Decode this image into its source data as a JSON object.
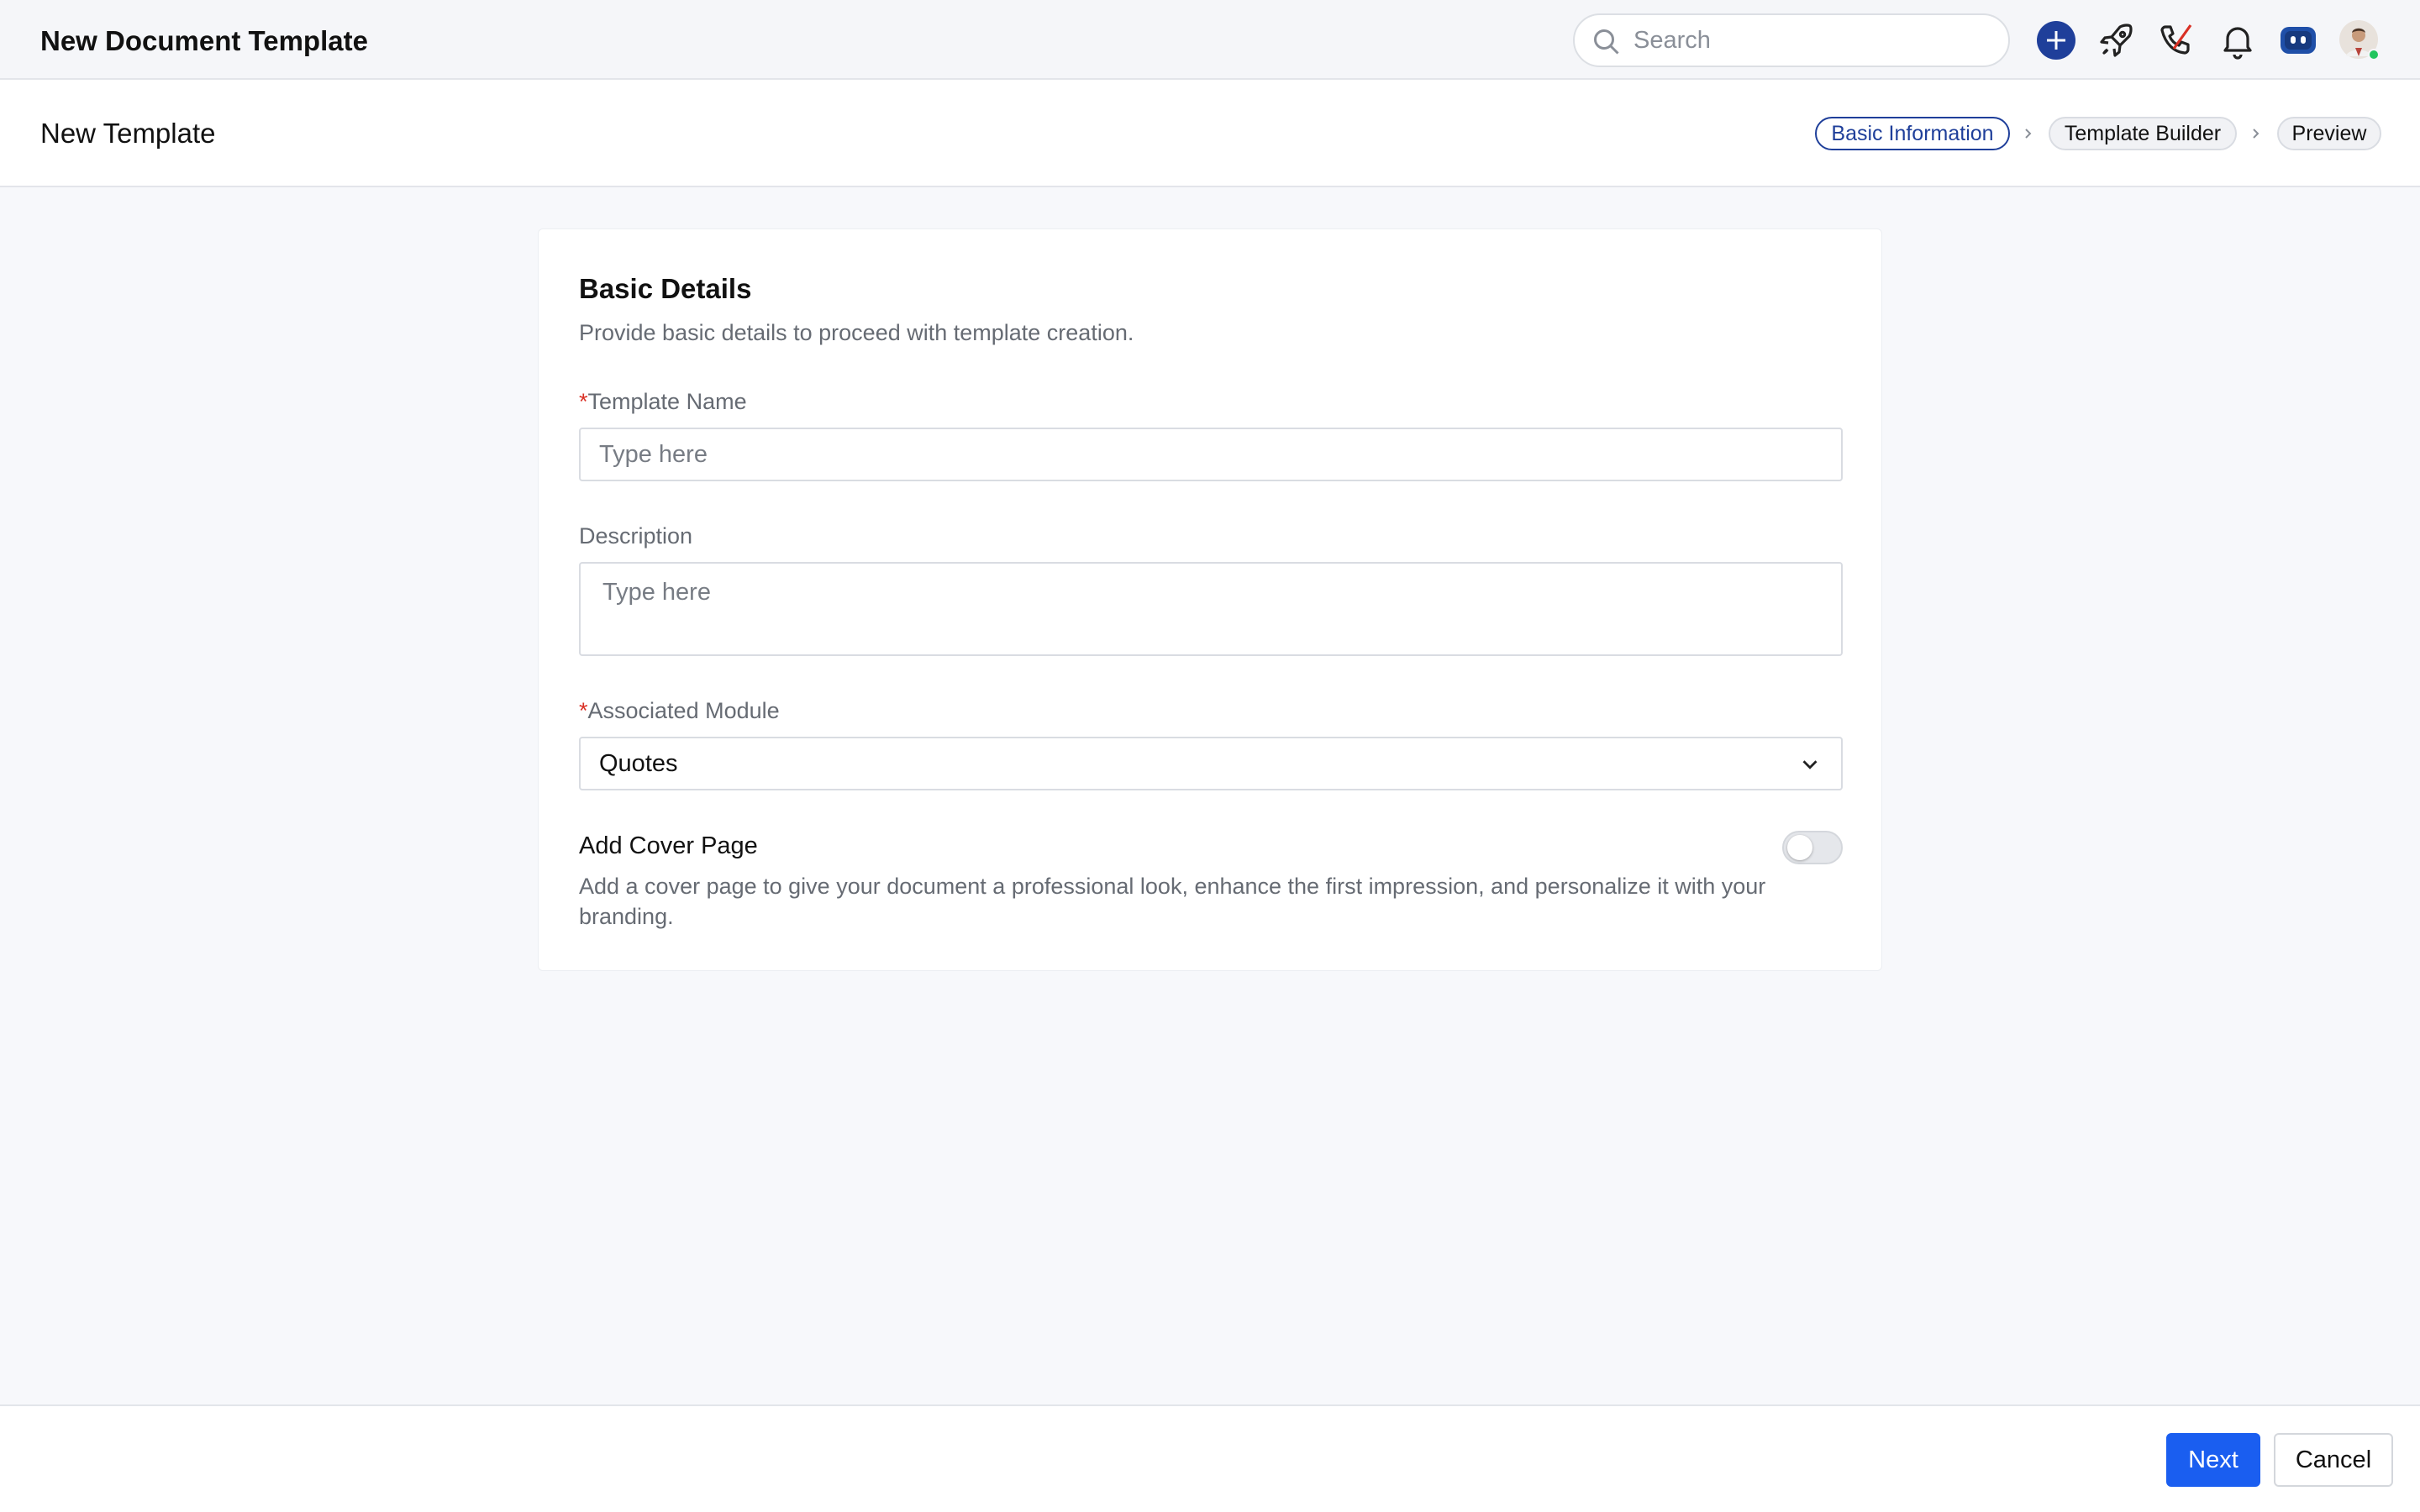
{
  "header": {
    "title": "New Document Template",
    "search_placeholder": "Search",
    "icons": [
      "search-icon",
      "plus-icon",
      "rocket-icon",
      "phone-icon",
      "bell-icon",
      "bot-icon",
      "avatar"
    ],
    "accent_color": "#1f3f9a"
  },
  "subheader": {
    "title": "New Template",
    "steps": [
      {
        "label": "Basic Information",
        "active": true
      },
      {
        "label": "Template Builder",
        "active": false
      },
      {
        "label": "Preview",
        "active": false
      }
    ]
  },
  "form": {
    "title": "Basic Details",
    "subtitle": "Provide basic details to proceed with template creation.",
    "required_mark": "*",
    "template_name": {
      "label": "Template Name",
      "placeholder": "Type here",
      "value": ""
    },
    "description": {
      "label": "Description",
      "placeholder": "Type here",
      "value": ""
    },
    "associated_module": {
      "label": "Associated Module",
      "value": "Quotes"
    },
    "cover_page": {
      "title": "Add Cover Page",
      "description": "Add a cover page to give your document a professional look, enhance the first impression, and personalize it with your branding.",
      "enabled": false
    }
  },
  "footer": {
    "next_label": "Next",
    "cancel_label": "Cancel",
    "primary_color": "#1a5ef0"
  }
}
